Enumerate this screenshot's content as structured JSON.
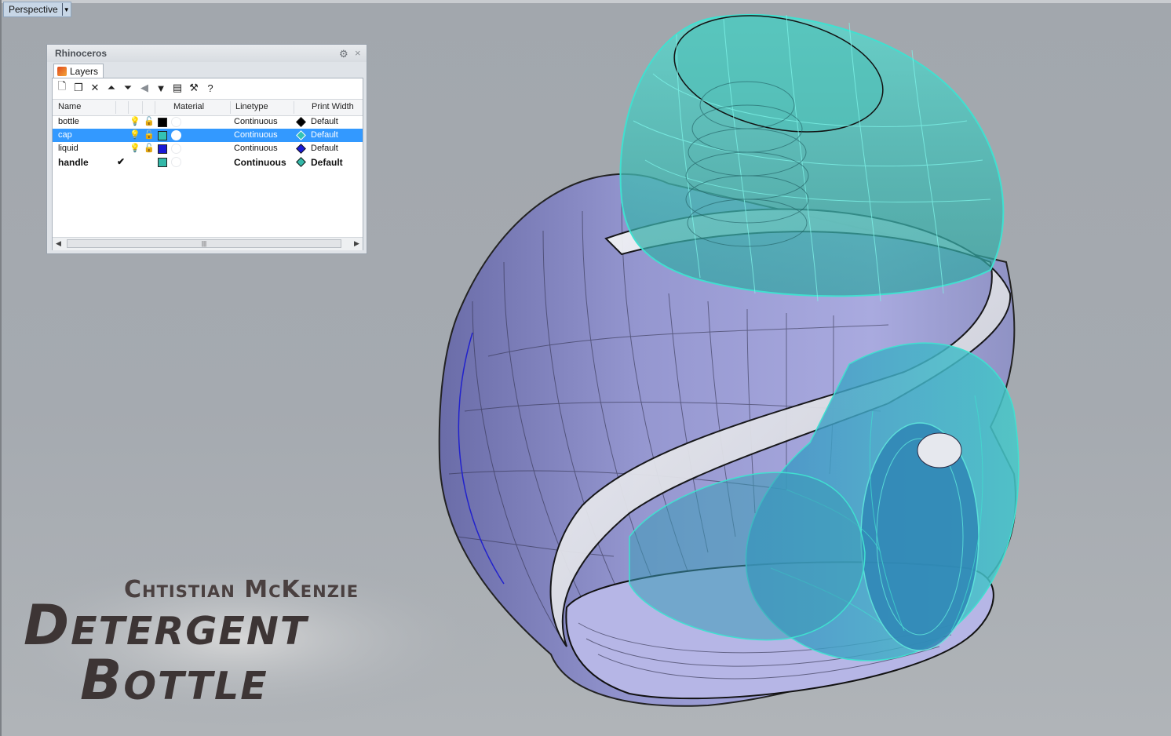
{
  "viewport": {
    "title": "Perspective"
  },
  "panel": {
    "title": "Rhinoceros",
    "tab_label": "Layers",
    "toolbar": [
      "new-layer-icon",
      "new-sublayer-icon",
      "delete-icon",
      "move-up-icon",
      "move-down-icon",
      "move-out-icon",
      "filter-icon",
      "tools-icon",
      "settings-wrench-icon",
      "help-icon"
    ],
    "columns": {
      "name": "Name",
      "material": "Material",
      "linetype": "Linetype",
      "print_width": "Print Width"
    },
    "layers": [
      {
        "name": "bottle",
        "color": "#000000",
        "linetype": "Continuous",
        "print_width": "Default",
        "print_color": "#000000",
        "current": false,
        "selected": false
      },
      {
        "name": "cap",
        "color": "#33c2b4",
        "linetype": "Continuous",
        "print_width": "Default",
        "print_color": "#33c2b4",
        "current": false,
        "selected": true
      },
      {
        "name": "liquid",
        "color": "#1a1ad6",
        "linetype": "Continuous",
        "print_width": "Default",
        "print_color": "#1a1ad6",
        "current": false,
        "selected": false
      },
      {
        "name": "handle",
        "color": "#33b8a8",
        "linetype": "Continuous",
        "print_width": "Default",
        "print_color": "#33b8a8",
        "current": true,
        "selected": false
      }
    ]
  },
  "overlay": {
    "author": "Chtistian McKenzie",
    "title_line1": "Detergent",
    "title_line2": "Bottle"
  },
  "colors": {
    "bottle_surface": "#9d9ed6",
    "cap_wire": "#40e0d0",
    "viewport_bg": "#a3a8ae",
    "selection": "#3399ff"
  }
}
